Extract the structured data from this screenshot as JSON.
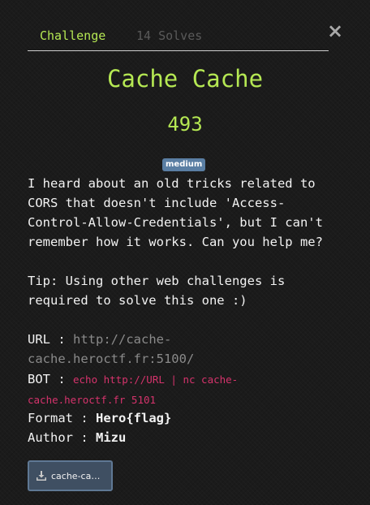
{
  "tabs": [
    {
      "label": "Challenge"
    },
    {
      "label": "14 Solves"
    }
  ],
  "close_icon": "×",
  "challenge": {
    "title": "Cache Cache",
    "points": "493",
    "difficulty": "medium",
    "description": "I heard about an old tricks related to\nCORS that doesn't include 'Access-\nControl-Allow-Credentials', but I can't\nremember how it works. Can you help me?\n\nTip: Using other web challenges is\nrequired to solve this one :)",
    "url_label": "URL : ",
    "url_value": "http://cache-\ncache.heroctf.fr:5100/",
    "bot_label": "BOT : ",
    "bot_value": "echo http://URL | nc cache-\ncache.heroctf.fr 5101",
    "format_label": "Format : ",
    "format_value": "Hero{flag}",
    "author_label": "Author : ",
    "author_value": "Mizu",
    "file_name": "cache-ca…"
  },
  "colors": {
    "accent": "#b5e853",
    "badge": "#5a7ea3",
    "bot_code": "#d6336c",
    "file_button": "#3f4f62"
  },
  "icons": {
    "close": "close-icon",
    "download": "download-icon"
  }
}
